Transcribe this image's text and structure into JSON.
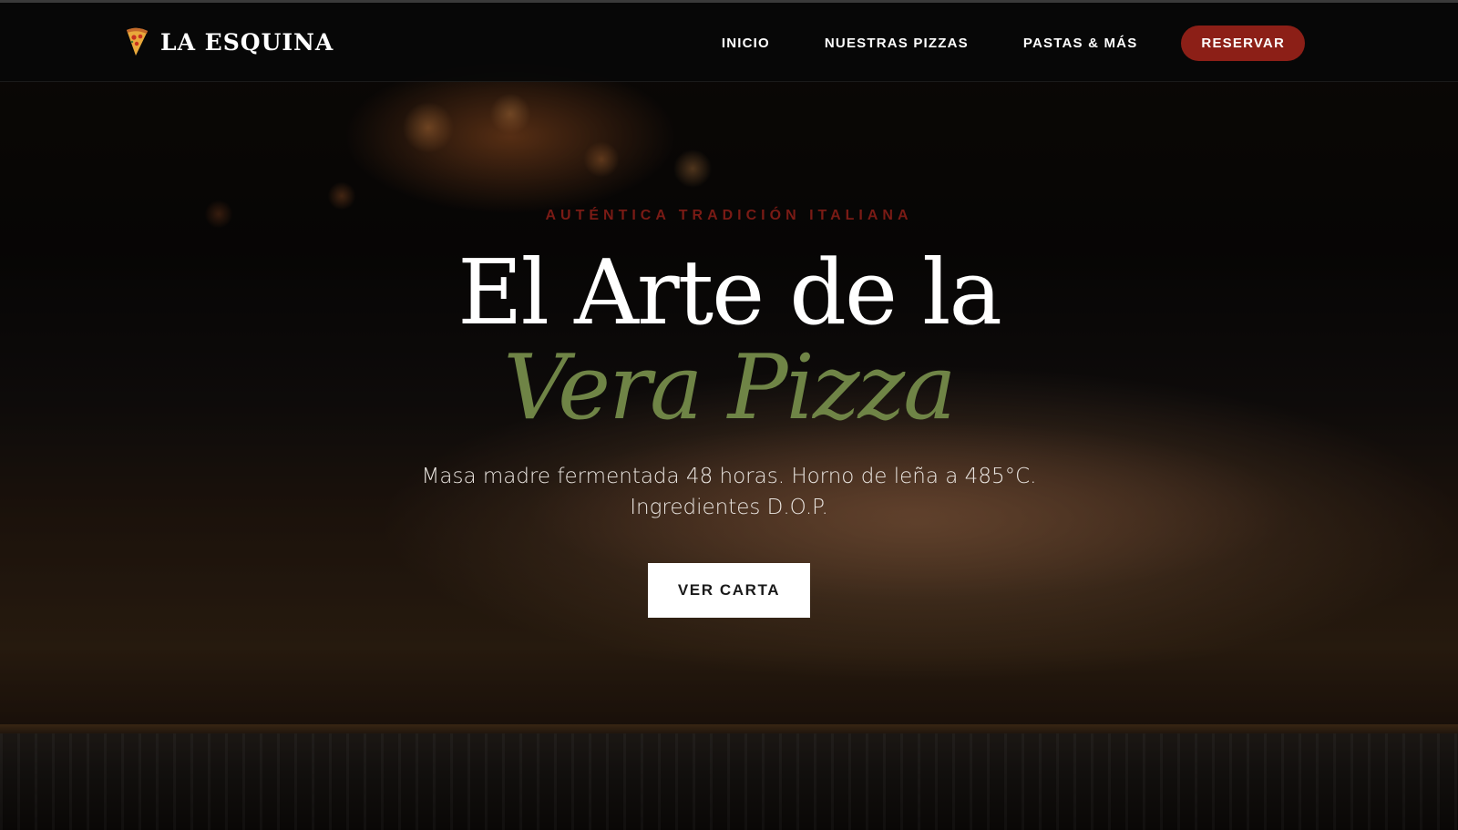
{
  "brand": {
    "name": "LA ESQUINA",
    "icon": "pizza-slice-icon"
  },
  "nav": {
    "items": [
      {
        "label": "INICIO"
      },
      {
        "label": "NUESTRAS PIZZAS"
      },
      {
        "label": "PASTAS & MÁS"
      }
    ],
    "cta_label": "RESERVAR"
  },
  "hero": {
    "eyebrow": "AUTÉNTICA TRADICIÓN ITALIANA",
    "title_line1": "El Arte de la",
    "title_line2": "Vera Pizza",
    "subtitle": "Masa madre fermentada 48 horas. Horno de leña a 485°C. Ingredientes D.O.P.",
    "cta_label": "VER CARTA"
  },
  "colors": {
    "accent_red": "#8c1f17",
    "eyebrow_red": "#7a1b15",
    "accent_green": "#6f8446",
    "nav_background": "#080808",
    "cta_background": "#ffffff"
  }
}
